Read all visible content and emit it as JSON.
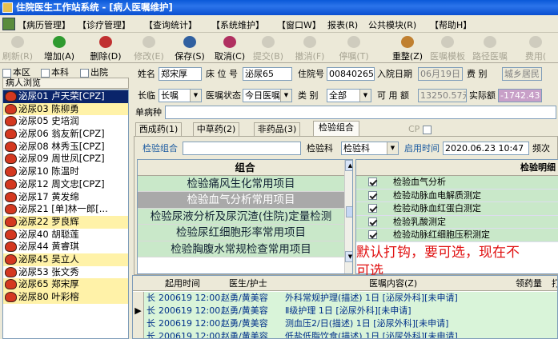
{
  "window": {
    "title": "住院医生工作站系统 - [病人医嘱维护]"
  },
  "menu": [
    "【病历管理】",
    "【诊疗管理】",
    "【查询统计】",
    "【系统维护】",
    "【窗口W】",
    "报表(R)",
    "公共模块(R)",
    "【帮助H】"
  ],
  "toolbar": [
    {
      "label": "刷新(R)",
      "enabled": false,
      "icon": "refresh-icon",
      "color": "#cfccbe"
    },
    {
      "label": "增加(A)",
      "enabled": true,
      "icon": "add-icon",
      "color": "#2f9a2f"
    },
    {
      "label": "删除(D)",
      "enabled": true,
      "icon": "delete-icon",
      "color": "#c03030"
    },
    {
      "label": "修改(E)",
      "enabled": false,
      "icon": "edit-icon",
      "color": "#cfccbe"
    },
    {
      "label": "保存(S)",
      "enabled": true,
      "icon": "save-icon",
      "color": "#3060a0"
    },
    {
      "label": "取消(C)",
      "enabled": true,
      "icon": "cancel-icon",
      "color": "#b03060"
    },
    {
      "label": "提交(B)",
      "enabled": false,
      "icon": "submit-icon",
      "color": "#cfccbe"
    },
    {
      "label": "撤消(F)",
      "enabled": false,
      "icon": "undo-icon",
      "color": "#cfccbe"
    },
    {
      "label": "停嘱(T)",
      "enabled": false,
      "icon": "stop-order-icon",
      "color": "#cfccbe"
    },
    {
      "label": "重整(Z)",
      "enabled": true,
      "icon": "reorganize-icon",
      "color": "#c08030"
    },
    {
      "label": "医嘱模板",
      "enabled": false,
      "icon": "order-template-icon",
      "color": "#cfccbe"
    },
    {
      "label": "路径医嘱",
      "enabled": false,
      "icon": "pathway-icon",
      "color": "#cfccbe"
    },
    {
      "label": "费用(",
      "enabled": false,
      "icon": "fee-icon",
      "color": "#cfccbe"
    }
  ],
  "filters": [
    {
      "label": "本区",
      "checked": false
    },
    {
      "label": "本科",
      "checked": false
    },
    {
      "label": "出院",
      "checked": false
    }
  ],
  "patient_browse": {
    "title": "病人浏览",
    "patients": [
      {
        "bed": "泌尿01",
        "name": "卢天荣[CPZ]",
        "state": "selected"
      },
      {
        "bed": "泌尿03",
        "name": "陈柳勇",
        "state": "yellow"
      },
      {
        "bed": "泌尿05",
        "name": "史培润",
        "state": ""
      },
      {
        "bed": "泌尿06",
        "name": "翁友新[CPZ]",
        "state": ""
      },
      {
        "bed": "泌尿08",
        "name": "林秀玉[CPZ]",
        "state": ""
      },
      {
        "bed": "泌尿09",
        "name": "周世凤[CPZ]",
        "state": ""
      },
      {
        "bed": "泌尿10",
        "name": "陈温时",
        "state": ""
      },
      {
        "bed": "泌尿12",
        "name": "周文忠[CPZ]",
        "state": ""
      },
      {
        "bed": "泌尿17",
        "name": "黄发绵",
        "state": ""
      },
      {
        "bed": "泌尿21",
        "name": "[单]林一郎[...",
        "state": ""
      },
      {
        "bed": "泌尿22",
        "name": "罗良辉",
        "state": "yellow"
      },
      {
        "bed": "泌尿40",
        "name": "胡聪莲",
        "state": ""
      },
      {
        "bed": "泌尿44",
        "name": "黄睿琪",
        "state": ""
      },
      {
        "bed": "泌尿45",
        "name": "吴立人",
        "state": "yellow"
      },
      {
        "bed": "泌尿53",
        "name": "张文秀",
        "state": ""
      },
      {
        "bed": "泌尿65",
        "name": "郑宋厚",
        "state": "yellow"
      },
      {
        "bed": "泌尿80",
        "name": "叶彩榕",
        "state": "yellow"
      }
    ]
  },
  "patient_info": {
    "name_label": "姓名",
    "name": "郑宋厚",
    "bed_label": "床 位 号",
    "bed": "泌尿65",
    "admission_label": "住院号",
    "admission_no": "00840265",
    "admit_date_label": "入院日期",
    "admit_date": "06月19日",
    "fee_label": "费 别",
    "fee_type": "城乡居民",
    "long_label": "长临",
    "long_value": "长嘱",
    "order_status_label": "医嘱状态",
    "order_status": "今日医嘱",
    "category_label": "类 别",
    "category": "全部",
    "available_label": "可 用 额",
    "available": "13250.57元",
    "actual_balance_label": "实际额",
    "actual_balance": "-1742.43",
    "disease_label": "单病种"
  },
  "tabs": [
    {
      "label": "西成药(1)",
      "active": false
    },
    {
      "label": "中草药(2)",
      "active": false
    },
    {
      "label": "非药品(3)",
      "active": false
    },
    {
      "label": "检验组合",
      "active": true
    }
  ],
  "cp_label": "CP",
  "lab_panel": {
    "group_label": "检验组合",
    "dept_label": "检验科",
    "dept_value": "检验科",
    "enable_time_label": "启用时间",
    "enable_time": "2020.06.23 10:47",
    "freq_label": "频次",
    "group_header": "组合",
    "groups": [
      "检验痛风生化常用项目",
      "检验血气分析常用项目",
      "检验尿液分析及尿沉渣(住院)定量检测",
      "检验尿红细胞形率常用项目",
      "检验胸腹水常规检查常用项目"
    ],
    "current_group_index": 1,
    "detail_header": "检验明细",
    "details": [
      {
        "name": "检验血气分析",
        "checked": true
      },
      {
        "name": "检验动脉血电解质测定",
        "checked": true
      },
      {
        "name": "检验动脉血红蛋白测定",
        "checked": true
      },
      {
        "name": "检验乳酸测定",
        "checked": true
      },
      {
        "name": "检验动脉红细胞压积测定",
        "checked": true
      }
    ]
  },
  "annotation": "默认打钩，要可选，现在不可选",
  "orders": {
    "headers": [
      "起用时间",
      "医生/护士",
      "医嘱内容(Z)",
      "领药量",
      "打"
    ],
    "rows": [
      {
        "type": "长",
        "time": "200619 12:00",
        "doctor": "赵勇/黄美容",
        "content": "外科常规护理(描述) 1日 [泌尿外科][未申请]",
        "marker": ""
      },
      {
        "type": "长",
        "time": "200619 12:00",
        "doctor": "赵勇/黄美容",
        "content": "Ⅱ级护理 1日 [泌尿外科][未申请]",
        "marker": "▶"
      },
      {
        "type": "长",
        "time": "200619 12:00",
        "doctor": "赵勇/黄美容",
        "content": "测血压2/日(描述) 1日 [泌尿外科][未申请]",
        "marker": ""
      },
      {
        "type": "长",
        "time": "200619 12:00",
        "doctor": "赵勇/黄美容",
        "content": "低盐低脂饮食(描述) 1日 [泌尿外科][未申请]",
        "marker": ""
      }
    ]
  }
}
